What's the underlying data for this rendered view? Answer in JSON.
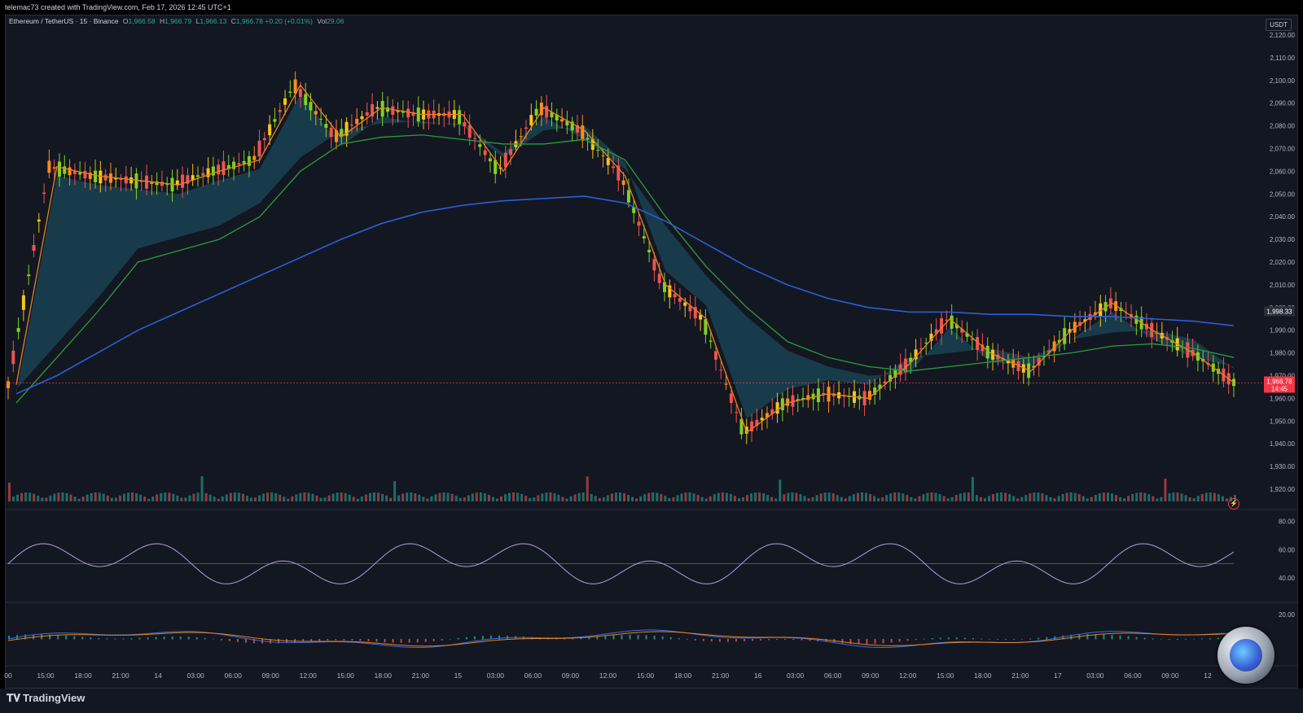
{
  "header": {
    "attribution": "telemac73 created with TradingView.com, Feb 17, 2026 12:45 UTC+1"
  },
  "legend": {
    "symbol": "Ethereum / TetherUS · 15 · Binance",
    "open_label": "O",
    "open": "1,966.58",
    "high_label": "H",
    "high": "1,966.79",
    "low_label": "L",
    "low": "1,966.13",
    "close_label": "C",
    "close": "1,966.78",
    "change": "+0.20 (+0.01%)",
    "vol_label": "Vol",
    "vol": "29.06"
  },
  "price_axis": {
    "currency": "USDT",
    "ticks": [
      "2,120.00",
      "2,110.00",
      "2,100.00",
      "2,090.00",
      "2,080.00",
      "2,070.00",
      "2,060.00",
      "2,050.00",
      "2,040.00",
      "2,030.00",
      "2,020.00",
      "2,010.00",
      "2,000.00",
      "1,990.00",
      "1,980.00",
      "1,970.00",
      "1,960.00",
      "1,950.00",
      "1,940.00",
      "1,930.00",
      "1,920.00"
    ],
    "ma_label": "1,998.33",
    "last_price": "1,966.78",
    "countdown": "14:45"
  },
  "rsi_axis": {
    "ticks": [
      "80.00",
      "60.00",
      "40.00"
    ]
  },
  "macd_axis": {
    "ticks": [
      "20.00"
    ]
  },
  "time_axis": [
    "00",
    "15:00",
    "18:00",
    "21:00",
    "14",
    "03:00",
    "06:00",
    "09:00",
    "12:00",
    "15:00",
    "18:00",
    "21:00",
    "15",
    "03:00",
    "06:00",
    "09:00",
    "12:00",
    "15:00",
    "18:00",
    "21:00",
    "16",
    "03:00",
    "06:00",
    "09:00",
    "12:00",
    "15:00",
    "18:00",
    "21:00",
    "17",
    "03:00",
    "06:00",
    "09:00",
    "12"
  ],
  "branding": {
    "name": "TradingView"
  },
  "colors": {
    "background": "#131722",
    "up": "#26a69a",
    "down": "#ef5350",
    "ema_fast": "#e8821e",
    "ema_mid": "#2a9d3a",
    "ema_slow": "#2d5fd6",
    "cloud_up": "#1e5a6e",
    "cloud_down": "#4a4c58",
    "rsi_up": "#9b59d0",
    "rsi_down": "#2ea86b",
    "macd_line": "#3b6fe0",
    "signal_line": "#e8821e"
  },
  "chart_data": {
    "type": "line",
    "title": "Ethereum / TetherUS · 15 · Binance",
    "x": [
      "15:00",
      "18:00",
      "21:00",
      "14",
      "03:00",
      "06:00",
      "09:00",
      "12:00",
      "15:00",
      "18:00",
      "21:00",
      "15",
      "03:00",
      "06:00",
      "09:00",
      "12:00",
      "15:00",
      "18:00",
      "21:00",
      "16",
      "03:00",
      "06:00",
      "09:00",
      "12:00",
      "15:00",
      "18:00",
      "21:00",
      "17",
      "03:00",
      "06:00",
      "09:00"
    ],
    "ylim": [
      1915,
      2125
    ],
    "series": [
      {
        "name": "",
        "values": [
          1966,
          2062,
          2058,
          2056,
          2054,
          2060,
          2065,
          2098,
          2075,
          2088,
          2085,
          2085,
          2060,
          2088,
          2078,
          2058,
          2010,
          1995,
          1945,
          1958,
          1962,
          1960,
          1975,
          1995,
          1980,
          1972,
          1990,
          2002,
          1990,
          1980,
          1967
        ]
      },
      {
        "name": "",
        "values": [
          1958,
          1978,
          1998,
          2020,
          2025,
          2030,
          2040,
          2060,
          2072,
          2075,
          2076,
          2074,
          2072,
          2072,
          2074,
          2065,
          2040,
          2018,
          2000,
          1985,
          1978,
          1974,
          1972,
          1974,
          1976,
          1978,
          1980,
          1983,
          1984,
          1982,
          1978
        ]
      },
      {
        "name": "",
        "values": [
          1962,
          1970,
          1980,
          1990,
          1998,
          2006,
          2014,
          2022,
          2030,
          2037,
          2042,
          2045,
          2047,
          2048,
          2049,
          2046,
          2038,
          2028,
          2018,
          2010,
          2004,
          2000,
          1998,
          1998,
          1997,
          1997,
          1996,
          1996,
          1995,
          1994,
          1992
        ]
      }
    ]
  }
}
